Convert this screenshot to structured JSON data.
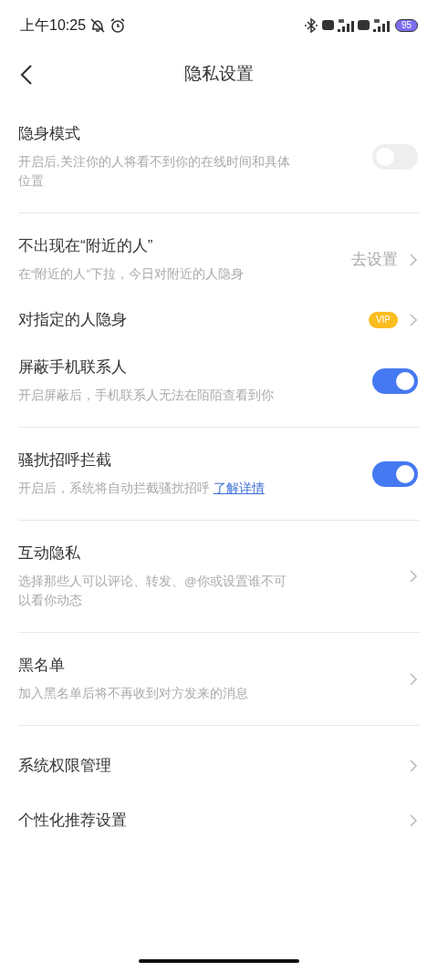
{
  "status_bar": {
    "time": "上午10:25",
    "battery": "95"
  },
  "header": {
    "title": "隐私设置"
  },
  "groups": [
    {
      "items": [
        {
          "kind": "toggle",
          "title": "隐身模式",
          "description": "开启后,关注你的人将看不到你的在线时间和具体位置",
          "on": false
        }
      ]
    },
    {
      "items": [
        {
          "kind": "link",
          "title": "不出现在“附近的人”",
          "description": "在“附近的人”下拉，今日对附近的人隐身",
          "value": "去设置"
        },
        {
          "kind": "badge",
          "title": "对指定的人隐身",
          "badge": "VIP"
        },
        {
          "kind": "toggle",
          "title": "屏蔽手机联系人",
          "description": "开启屏蔽后，手机联系人无法在陌陌查看到你",
          "on": true
        }
      ]
    },
    {
      "items": [
        {
          "kind": "toggle",
          "title": "骚扰招呼拦截",
          "description": "开启后，系统将自动拦截骚扰招呼",
          "link": "了解详情",
          "on": true
        }
      ]
    },
    {
      "items": [
        {
          "kind": "nav",
          "title": "互动隐私",
          "description": "选择那些人可以评论、转发、@你或设置谁不可以看你动态"
        }
      ]
    },
    {
      "items": [
        {
          "kind": "nav",
          "title": "黑名单",
          "description": "加入黑名单后将不再收到对方发来的消息"
        }
      ]
    },
    {
      "items": [
        {
          "kind": "nav",
          "title": "系统权限管理"
        },
        {
          "kind": "nav",
          "title": "个性化推荐设置"
        }
      ]
    }
  ]
}
